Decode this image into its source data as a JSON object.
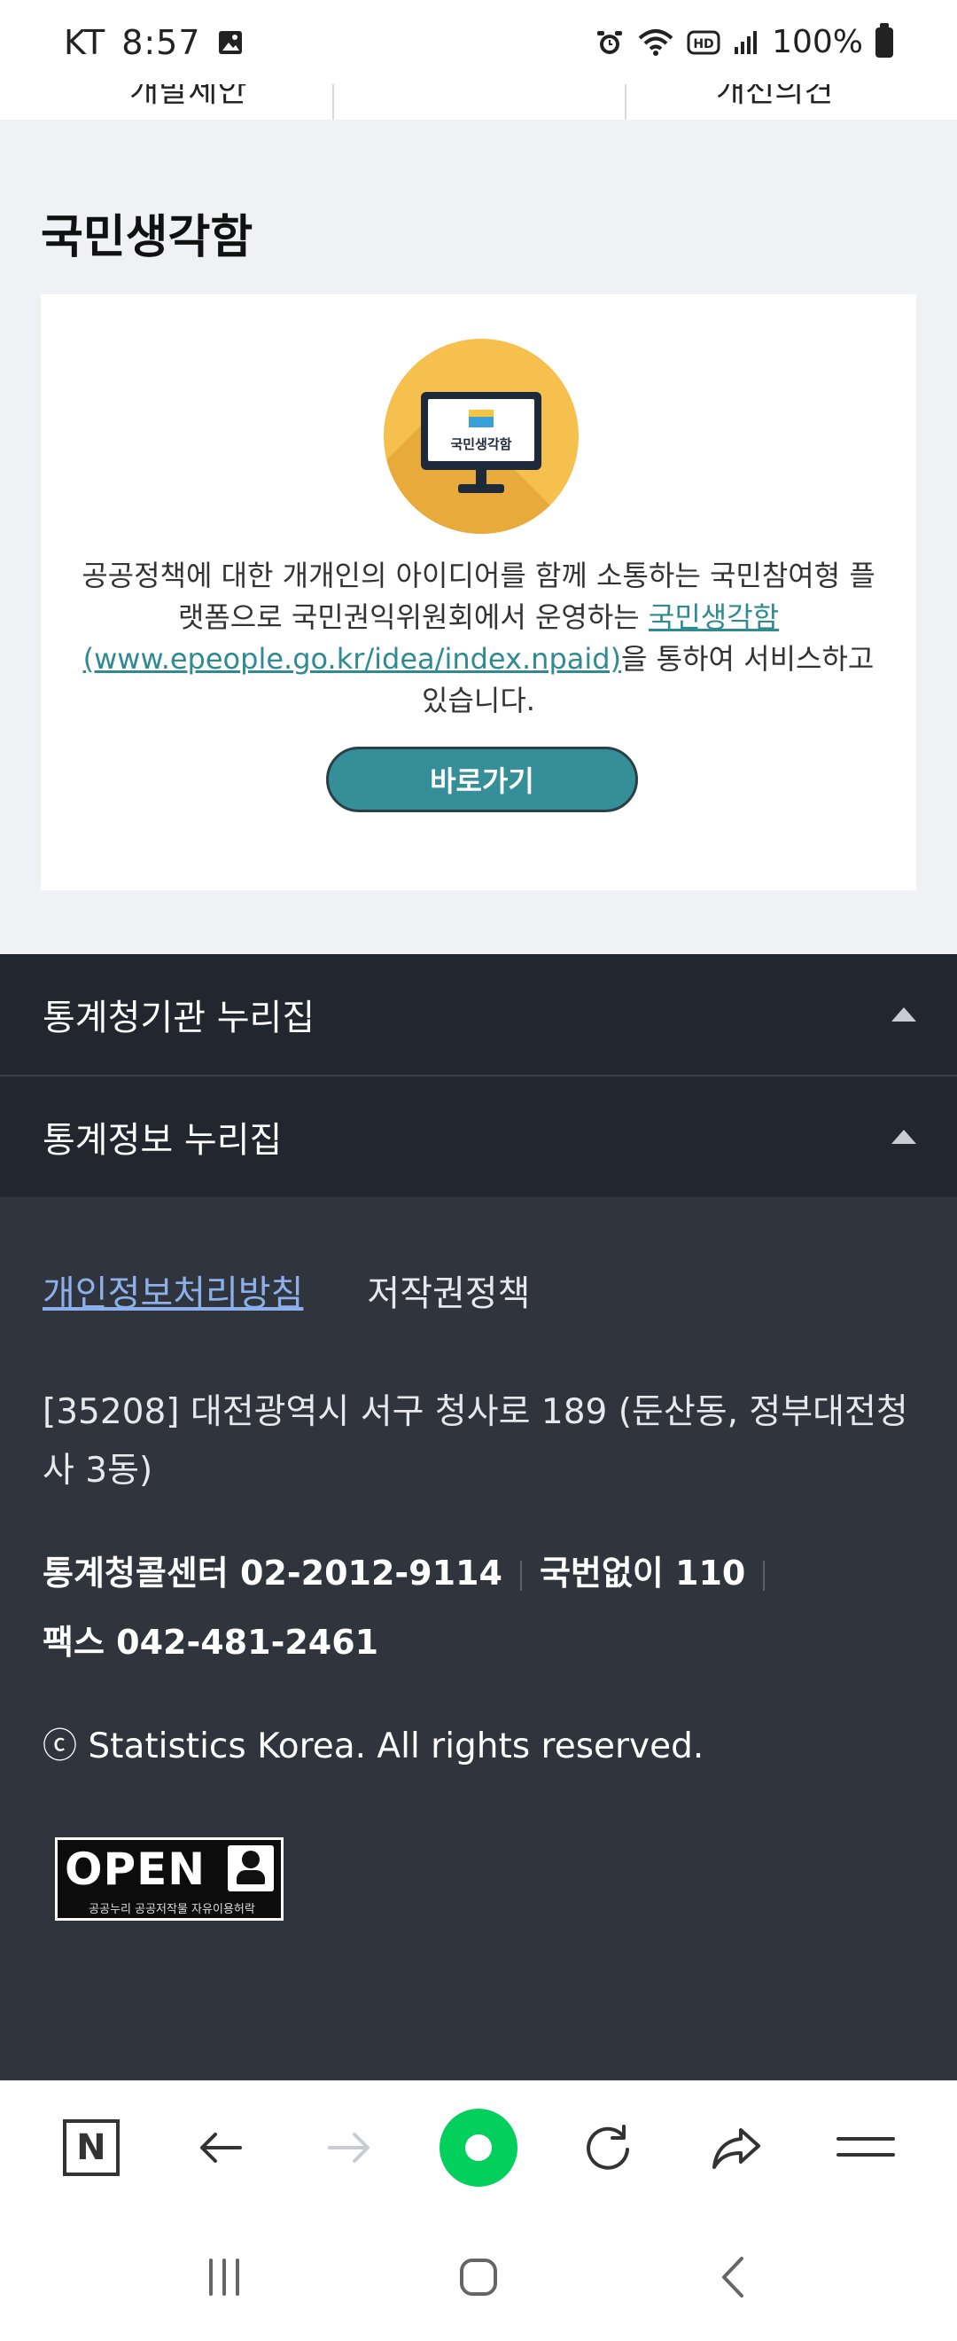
{
  "status_bar": {
    "carrier": "KT",
    "time": "8:57",
    "battery": "100%",
    "icons": [
      "gallery-icon",
      "alarm-icon",
      "wifi-icon",
      "hd-icon",
      "signal-icon",
      "battery-icon"
    ]
  },
  "top_tabs": {
    "left": "개발제안",
    "right": "개선의견"
  },
  "section": {
    "title": "국민생각함"
  },
  "card": {
    "illustration_text": "국민생각함",
    "desc_before": "공공정책에 대한 개개인의 아이디어를 함께 소통하는 국민참여형 플랫폼으로 국민권익위원회에서 운영하는 ",
    "desc_link": "국민생각함(www.epeople.go.kr/idea/index.npaid)",
    "desc_after": "을 통하여 서비스하고 있습니다.",
    "button_label": "바로가기",
    "accent_color": "#358f98"
  },
  "accordions": [
    {
      "label": "통계청기관 누리집"
    },
    {
      "label": "통계정보 누리집"
    }
  ],
  "footer": {
    "links": {
      "privacy": "개인정보처리방침",
      "copyright_policy": "저작권정책"
    },
    "address": "[35208] 대전광역시 서구 청사로 189 (둔산동, 정부대전청사 3동)",
    "call_center": "통계청콜센터 02-2012-9114",
    "national_no": "국번없이 110",
    "fax": "팩스 042-481-2461",
    "copyright": "ⓒ Statistics Korea. All rights reserved.",
    "badge": {
      "main": "OPEN",
      "sub": "공공누리  공공저작물 자유이용허락"
    }
  },
  "toolbar": {
    "buttons": [
      "naver-n-icon",
      "back-arrow-icon",
      "forward-arrow-icon",
      "green-dot-icon",
      "refresh-icon",
      "share-icon",
      "menu-icon"
    ]
  },
  "navbar": {
    "buttons": [
      "recent-apps-icon",
      "home-icon",
      "back-icon"
    ]
  }
}
